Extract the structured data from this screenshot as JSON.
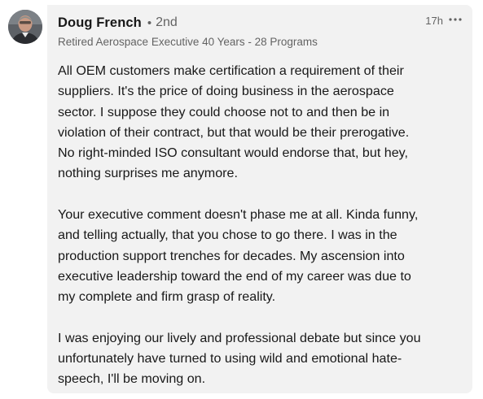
{
  "comment": {
    "author": {
      "name": "Doug French",
      "degree": "2nd",
      "headline": "Retired Aerospace Executive 40 Years - 28 Programs"
    },
    "timestamp": "17h",
    "more_icon": "ellipsis-horizontal-icon",
    "avatar_icon": "profile-photo",
    "bubble_color": "#f2f2f2",
    "paragraphs": [
      "All OEM customers make certification a requirement of their\nsuppliers. It's the price of doing business in the aerospace\nsector. I suppose they could choose not to and then be in\nviolation of their contract, but that would be their prerogative.\nNo right-minded ISO consultant would endorse that, but hey,\nnothing surprises me anymore.",
      "Your executive comment doesn't phase me at all. Kinda funny,\nand telling actually, that you chose to go there. I was in the\nproduction support trenches for decades. My ascension into\nexecutive leadership toward the end of my career was due to\nmy complete and firm grasp of reality.",
      "I was enjoying our lively and professional debate but since you\nunfortunately have turned to using wild and emotional hate-\nspeech, I'll be moving on."
    ]
  }
}
